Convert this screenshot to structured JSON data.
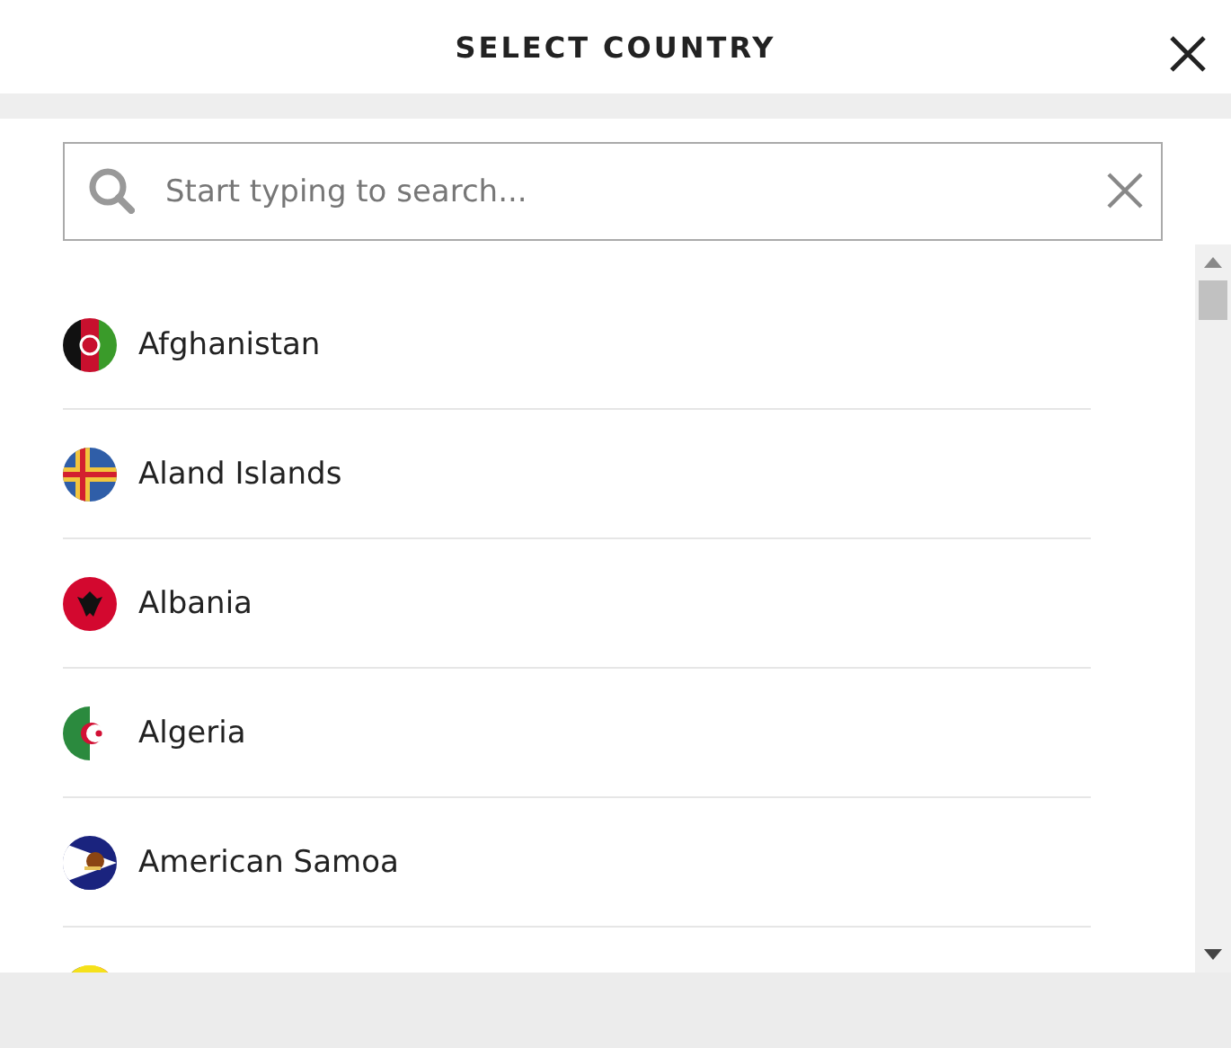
{
  "dialog": {
    "title": "SELECT COUNTRY"
  },
  "search": {
    "placeholder": "Start typing to search..."
  },
  "countries": [
    {
      "name": "Afghanistan",
      "kind": "afghanistan"
    },
    {
      "name": "Aland Islands",
      "kind": "aland"
    },
    {
      "name": "Albania",
      "kind": "albania"
    },
    {
      "name": "Algeria",
      "kind": "algeria"
    },
    {
      "name": "American Samoa",
      "kind": "samoa"
    },
    {
      "kind": "andorra"
    }
  ]
}
